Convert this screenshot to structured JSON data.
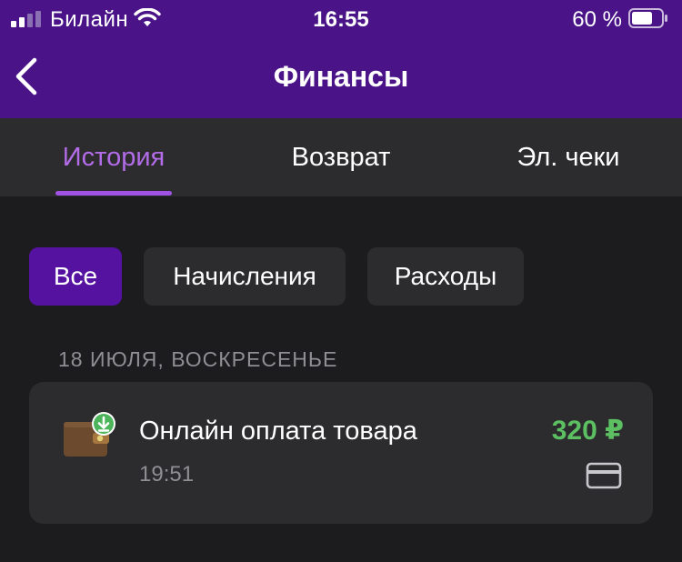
{
  "status_bar": {
    "carrier": "Билайн",
    "time": "16:55",
    "battery": "60 %",
    "signal_icon": "signal-bars-icon",
    "wifi_icon": "wifi-icon",
    "battery_icon": "battery-icon"
  },
  "header": {
    "title": "Финансы",
    "back_icon": "chevron-left-icon"
  },
  "tabs": [
    {
      "label": "История",
      "active": true
    },
    {
      "label": "Возврат",
      "active": false
    },
    {
      "label": "Эл. чеки",
      "active": false
    }
  ],
  "filters": [
    {
      "label": "Все",
      "active": true
    },
    {
      "label": "Начисления",
      "active": false
    },
    {
      "label": "Расходы",
      "active": false
    }
  ],
  "history": {
    "date_header": "18 ИЮЛЯ, ВОСКРЕСЕНЬЕ",
    "transactions": [
      {
        "title": "Онлайн оплата товара",
        "time": "19:51",
        "amount": "320 ₽",
        "icon": "wallet-download-icon",
        "payment_method_icon": "credit-card-icon"
      }
    ]
  },
  "colors": {
    "header_bg": "#4a1488",
    "accent": "#a052e4",
    "active_chip": "#5511a0",
    "amount_positive": "#5cbf62",
    "background": "#1c1c1e",
    "surface": "#2c2c2e"
  }
}
